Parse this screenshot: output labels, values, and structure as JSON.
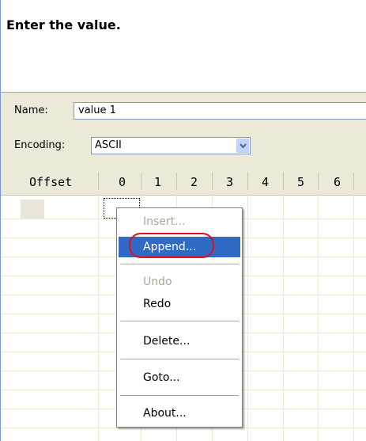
{
  "header": {
    "title": "Enter the value."
  },
  "form": {
    "name_label": "Name:",
    "name_value": "value 1",
    "encoding_label": "Encoding:",
    "encoding_value": "ASCII"
  },
  "grid": {
    "offset_label": "Offset",
    "columns": [
      "0",
      "1",
      "2",
      "3",
      "4",
      "5",
      "6"
    ]
  },
  "context_menu": {
    "items": [
      {
        "label": "Insert...",
        "enabled": false
      },
      {
        "label": "Append...",
        "enabled": true,
        "highlighted": true
      },
      {
        "label": "Undo",
        "enabled": false
      },
      {
        "label": "Redo",
        "enabled": true
      },
      {
        "label": "Delete...",
        "enabled": true
      },
      {
        "label": "Goto...",
        "enabled": true
      },
      {
        "label": "About...",
        "enabled": true
      }
    ]
  },
  "colors": {
    "highlight": "#316ac5",
    "annotation_ring": "#e0101a",
    "panel": "#ece9d8"
  }
}
